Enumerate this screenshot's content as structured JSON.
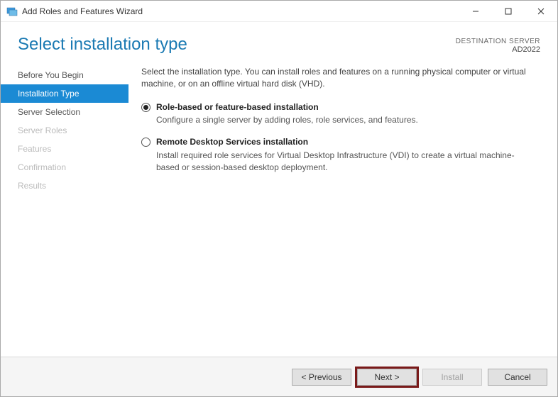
{
  "window": {
    "title": "Add Roles and Features Wizard"
  },
  "header": {
    "heading": "Select installation type",
    "destination_label": "DESTINATION SERVER",
    "destination_name": "AD2022"
  },
  "sidebar": {
    "items": [
      {
        "label": "Before You Begin",
        "state": "enabled"
      },
      {
        "label": "Installation Type",
        "state": "active"
      },
      {
        "label": "Server Selection",
        "state": "enabled"
      },
      {
        "label": "Server Roles",
        "state": "disabled"
      },
      {
        "label": "Features",
        "state": "disabled"
      },
      {
        "label": "Confirmation",
        "state": "disabled"
      },
      {
        "label": "Results",
        "state": "disabled"
      }
    ]
  },
  "content": {
    "intro": "Select the installation type. You can install roles and features on a running physical computer or virtual machine, or on an offline virtual hard disk (VHD).",
    "option1": {
      "title": "Role-based or feature-based installation",
      "desc": "Configure a single server by adding roles, role services, and features.",
      "selected": true
    },
    "option2": {
      "title": "Remote Desktop Services installation",
      "desc": "Install required role services for Virtual Desktop Infrastructure (VDI) to create a virtual machine-based or session-based desktop deployment.",
      "selected": false
    }
  },
  "footer": {
    "previous": "< Previous",
    "next": "Next >",
    "install": "Install",
    "cancel": "Cancel"
  }
}
